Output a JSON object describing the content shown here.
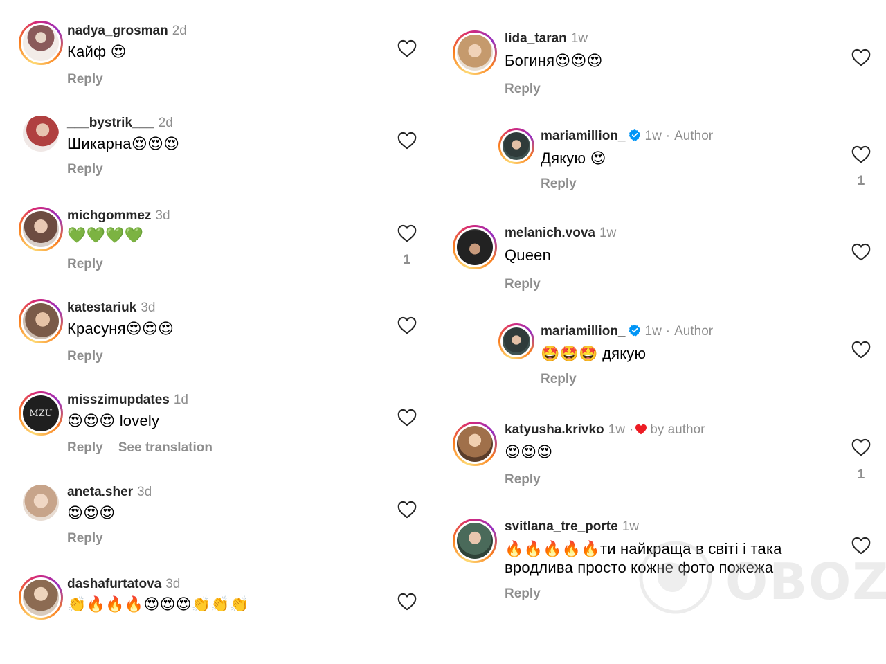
{
  "labels": {
    "reply": "Reply",
    "see_translation": "See translation",
    "author": "Author",
    "by_author": "by author",
    "dot": "·"
  },
  "left": [
    {
      "username": "nadya_grosman",
      "time": "2d",
      "text": "Кайф 😍",
      "likes": "",
      "has_story_ring": true,
      "avatar_color": "#8a5a5a"
    },
    {
      "username": "___bystrik___",
      "time": "2d",
      "text": "Шикарна😍😍😍",
      "likes": "",
      "has_story_ring": false,
      "avatar_color": "#b04040"
    },
    {
      "username": "michgommez",
      "time": "3d",
      "text": "💚💚💚💚",
      "likes": "1",
      "has_story_ring": true,
      "avatar_color": "#6d4c41"
    },
    {
      "username": "katestariuk",
      "time": "3d",
      "text": "Красуня😍😍😍",
      "likes": "",
      "has_story_ring": true,
      "avatar_color": "#7a5a48"
    },
    {
      "username": "misszimupdates",
      "time": "1d",
      "text": "😍😍😍 lovely",
      "likes": "",
      "has_story_ring": true,
      "avatar_color": "#1f1f1f",
      "avatar_text": "MZU",
      "see_translation": true
    },
    {
      "username": "aneta.sher",
      "time": "3d",
      "text": "😍😍😍",
      "likes": "",
      "has_story_ring": false,
      "avatar_color": "#c7a48a"
    },
    {
      "username": "dashafurtatova",
      "time": "3d",
      "text": "👏🔥🔥🔥😍😍😍👏👏👏",
      "likes": "",
      "has_story_ring": true,
      "avatar_color": "#8c6b52"
    }
  ],
  "right": [
    {
      "username": "lida_taran",
      "time": "1w",
      "text": "Богиня😍😍😍",
      "likes": "",
      "has_story_ring": true,
      "avatar_color": "#c59a6d"
    },
    {
      "username": "mariamillion_",
      "time": "1w",
      "text": "Дякую 😍",
      "likes": "1",
      "verified": true,
      "author": true,
      "avatar_color": "#2f3b3a"
    },
    {
      "username": "melanich.vova",
      "time": "1w",
      "text": "Queen",
      "likes": "",
      "has_story_ring": true,
      "avatar_color": "#222222"
    },
    {
      "username": "mariamillion_",
      "time": "1w",
      "text": "🤩🤩🤩 дякую",
      "likes": "",
      "verified": true,
      "author": true,
      "avatar_color": "#2f3b3a"
    },
    {
      "username": "katyusha.krivko",
      "time": "1w",
      "text": "😍😍😍",
      "likes": "1",
      "has_story_ring": true,
      "liked_by_author": true,
      "avatar_color": "#a0704a"
    },
    {
      "username": "svitlana_tre_porte",
      "time": "1w",
      "text": "🔥🔥🔥🔥🔥ти найкраща в світі і така вродлива просто кожне фото пожежа",
      "likes": "",
      "has_story_ring": true,
      "avatar_color": "#4a6a5a"
    }
  ],
  "watermark": "OBOZ.UA",
  "colors": {
    "ring_start": "#feda75",
    "ring_mid": "#d62976",
    "ring_end": "#962fbf",
    "verified": "#0095f6",
    "red_heart": "#ed1c24",
    "muted": "#8e8e8e"
  }
}
